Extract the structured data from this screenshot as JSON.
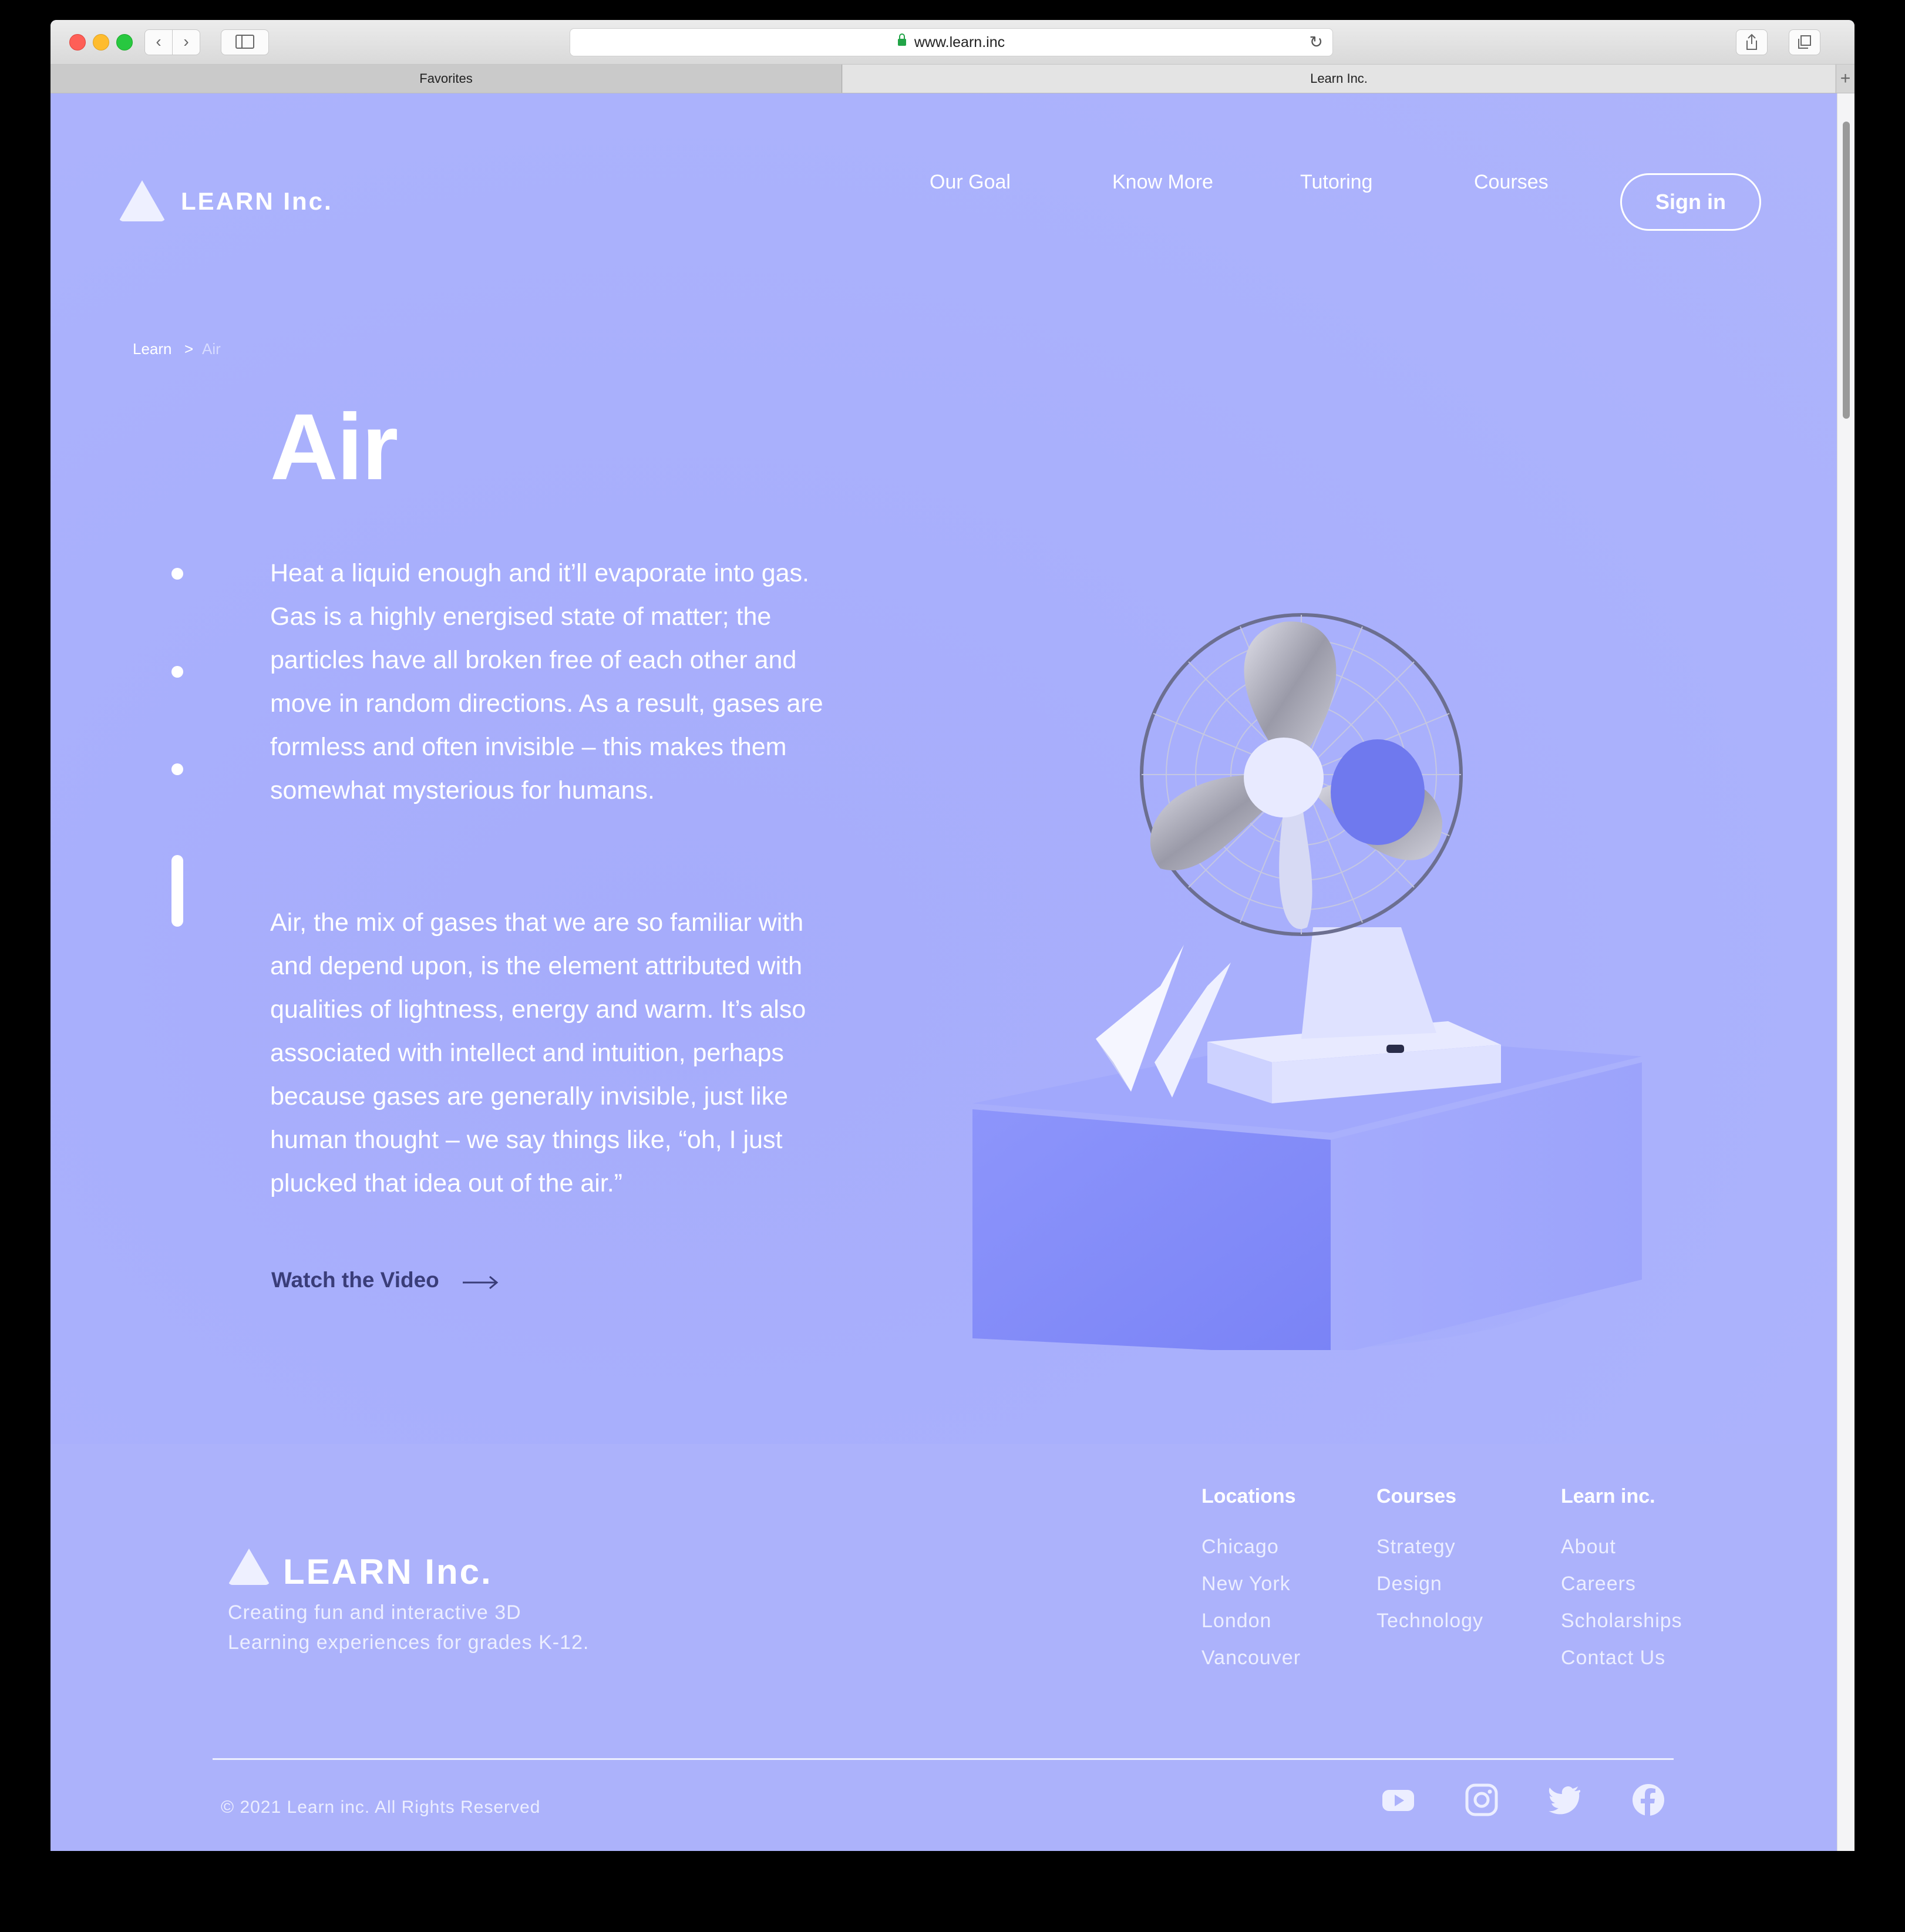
{
  "browser": {
    "url": "www.learn.inc",
    "tabs": [
      {
        "label": "Favorites"
      },
      {
        "label": "Learn Inc."
      }
    ],
    "new_tab": "+"
  },
  "header": {
    "logo_text": "LEARN Inc.",
    "nav": [
      "Our Goal",
      "Know More",
      "Tutoring",
      "Courses"
    ],
    "signin_label": "Sign in"
  },
  "breadcrumb": {
    "root": "Learn",
    "separator": ">",
    "current": "Air"
  },
  "main": {
    "title": "Air",
    "paragraph1": "Heat a liquid enough and it’ll evaporate into gas. Gas is a highly energised state of matter; the particles have all broken free of each other and move in random directions. As a result, gases are formless and often invisible – this makes them somewhat mysterious for humans.",
    "paragraph2": "Air, the mix of gases that we are so familiar with and depend upon, is the element attributed with qualities of lightness, energy and warm. It’s also associated with intellect and intuition, perhaps because gases are generally invisible, just like human thought – we  say things like, “oh, I just plucked that idea out of the air.”",
    "watch_label": "Watch the Video",
    "pager_count": 4,
    "pager_active": 4
  },
  "footer": {
    "logo_text": "LEARN Inc.",
    "tagline_line1": "Creating fun and interactive 3D",
    "tagline_line2": "Learning  experiences for grades K-12.",
    "columns": [
      {
        "heading": "Locations",
        "items": [
          "Chicago",
          "New York",
          "London",
          "Vancouver"
        ]
      },
      {
        "heading": "Courses",
        "items": [
          "Strategy",
          "Design",
          "Technology"
        ]
      },
      {
        "heading": "Learn inc.",
        "items": [
          "About",
          "Careers",
          "Scholarships",
          "Contact Us"
        ]
      }
    ],
    "copyright": "© 2021 Learn inc. All Rights Reserved",
    "social": [
      "youtube-icon",
      "instagram-icon",
      "twitter-icon",
      "facebook-icon"
    ]
  },
  "colors": {
    "page_bg": "#aab1fc",
    "text_dark": "#3a3d79",
    "white": "#ffffff"
  }
}
